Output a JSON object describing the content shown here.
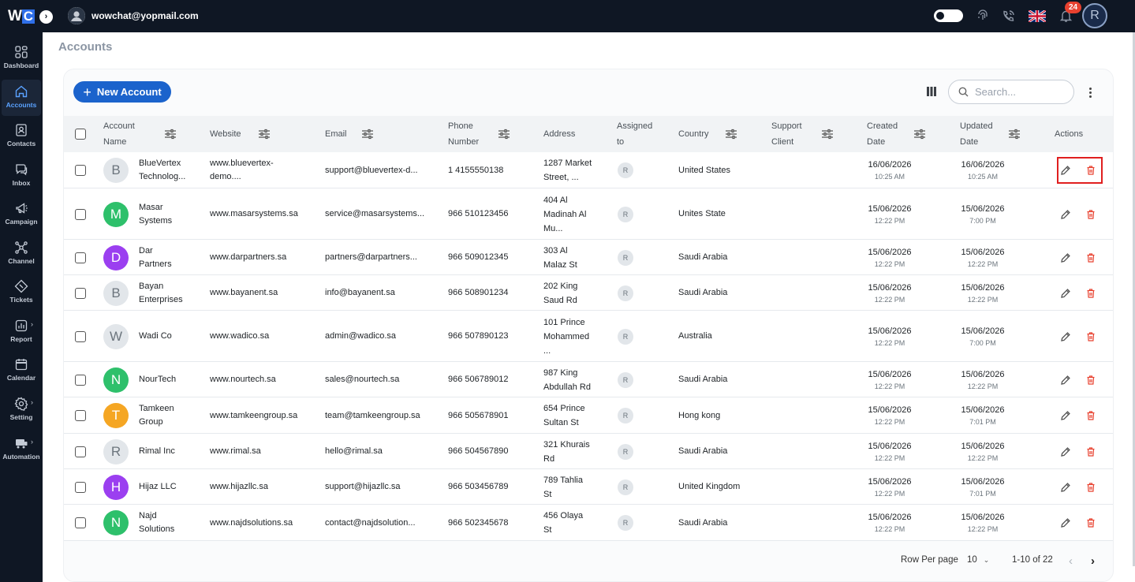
{
  "topbar": {
    "logo_w": "W",
    "logo_c": "C",
    "user_email": "wowchat@yopmail.com",
    "notifications_count": "24",
    "avatar_initial": "R"
  },
  "sidebar": {
    "items": [
      {
        "label": "Dashboard",
        "icon": "dashboard-icon"
      },
      {
        "label": "Accounts",
        "icon": "home-icon",
        "active": true
      },
      {
        "label": "Contacts",
        "icon": "contacts-icon"
      },
      {
        "label": "Inbox",
        "icon": "inbox-icon"
      },
      {
        "label": "Campaign",
        "icon": "megaphone-icon"
      },
      {
        "label": "Channel",
        "icon": "channel-icon"
      },
      {
        "label": "Tickets",
        "icon": "ticket-icon"
      },
      {
        "label": "Report",
        "icon": "report-icon"
      },
      {
        "label": "Calendar",
        "icon": "calendar-icon"
      },
      {
        "label": "Setting",
        "icon": "gear-icon"
      },
      {
        "label": "Automation",
        "icon": "automation-icon"
      }
    ]
  },
  "page": {
    "title": "Accounts",
    "new_button": "New Account",
    "search_placeholder": "Search..."
  },
  "table": {
    "headers": {
      "account_name_1": "Account",
      "account_name_2": "Name",
      "website": "Website",
      "email": "Email",
      "phone_1": "Phone",
      "phone_2": "Number",
      "address": "Address",
      "assigned_1": "Assigned",
      "assigned_2": "to",
      "country": "Country",
      "support_1": "Support",
      "support_2": "Client",
      "created_1": "Created",
      "created_2": "Date",
      "updated_1": "Updated",
      "updated_2": "Date",
      "actions": "Actions"
    },
    "rows": [
      {
        "initial": "B",
        "name1": "BlueVertex",
        "name2": "Technolog...",
        "web1": "www.bluevertex-",
        "web2": "demo....",
        "email": "support@bluevertex-d...",
        "phone": "1 4155550138",
        "addr1": "1287 Market",
        "addr2": "Street, ...",
        "addr3": "",
        "assigned": "R",
        "country": "United States",
        "cdate": "16/06/2026",
        "ctime": "10:25 AM",
        "udate": "16/06/2026",
        "utime": "10:25 AM"
      },
      {
        "initial": "M",
        "name1": "Masar",
        "name2": "Systems",
        "web1": "www.masarsystems.sa",
        "web2": "",
        "email": "service@masarsystems...",
        "phone": "966 510123456",
        "addr1": "404 Al",
        "addr2": "Madinah Al",
        "addr3": "Mu...",
        "assigned": "R",
        "country": "Unites State",
        "cdate": "15/06/2026",
        "ctime": "12:22 PM",
        "udate": "15/06/2026",
        "utime": "7:00 PM"
      },
      {
        "initial": "D",
        "name1": "Dar",
        "name2": "Partners",
        "web1": "www.darpartners.sa",
        "web2": "",
        "email": "partners@darpartners...",
        "phone": "966 509012345",
        "addr1": "303 Al",
        "addr2": "Malaz St",
        "addr3": "",
        "assigned": "R",
        "country": "Saudi Arabia",
        "cdate": "15/06/2026",
        "ctime": "12:22 PM",
        "udate": "15/06/2026",
        "utime": "12:22 PM"
      },
      {
        "initial": "B",
        "name1": "Bayan",
        "name2": "Enterprises",
        "web1": "www.bayanent.sa",
        "web2": "",
        "email": "info@bayanent.sa",
        "phone": "966 508901234",
        "addr1": "202 King",
        "addr2": "Saud Rd",
        "addr3": "",
        "assigned": "R",
        "country": "Saudi Arabia",
        "cdate": "15/06/2026",
        "ctime": "12:22 PM",
        "udate": "15/06/2026",
        "utime": "12:22 PM"
      },
      {
        "initial": "W",
        "name1": "Wadi Co",
        "name2": "",
        "web1": "www.wadico.sa",
        "web2": "",
        "email": "admin@wadico.sa",
        "phone": "966 507890123",
        "addr1": "101 Prince",
        "addr2": "Mohammed",
        "addr3": "...",
        "assigned": "R",
        "country": "Australia",
        "cdate": "15/06/2026",
        "ctime": "12:22 PM",
        "udate": "15/06/2026",
        "utime": "7:00 PM"
      },
      {
        "initial": "N",
        "name1": "NourTech",
        "name2": "",
        "web1": "www.nourtech.sa",
        "web2": "",
        "email": "sales@nourtech.sa",
        "phone": "966 506789012",
        "addr1": "987 King",
        "addr2": "Abdullah Rd",
        "addr3": "",
        "assigned": "R",
        "country": "Saudi Arabia",
        "cdate": "15/06/2026",
        "ctime": "12:22 PM",
        "udate": "15/06/2026",
        "utime": "12:22 PM"
      },
      {
        "initial": "T",
        "name1": "Tamkeen",
        "name2": "Group",
        "web1": "www.tamkeengroup.sa",
        "web2": "",
        "email": "team@tamkeengroup.sa",
        "phone": "966 505678901",
        "addr1": "654 Prince",
        "addr2": "Sultan St",
        "addr3": "",
        "assigned": "R",
        "country": "Hong kong",
        "cdate": "15/06/2026",
        "ctime": "12:22 PM",
        "udate": "15/06/2026",
        "utime": "7:01 PM"
      },
      {
        "initial": "R",
        "name1": "Rimal Inc",
        "name2": "",
        "web1": "www.rimal.sa",
        "web2": "",
        "email": "hello@rimal.sa",
        "phone": "966 504567890",
        "addr1": "321 Khurais",
        "addr2": "Rd",
        "addr3": "",
        "assigned": "R",
        "country": "Saudi Arabia",
        "cdate": "15/06/2026",
        "ctime": "12:22 PM",
        "udate": "15/06/2026",
        "utime": "12:22 PM"
      },
      {
        "initial": "H",
        "name1": "Hijaz LLC",
        "name2": "",
        "web1": "www.hijazllc.sa",
        "web2": "",
        "email": "support@hijazllc.sa",
        "phone": "966 503456789",
        "addr1": "789 Tahlia",
        "addr2": "St",
        "addr3": "",
        "assigned": "R",
        "country": "United Kingdom",
        "cdate": "15/06/2026",
        "ctime": "12:22 PM",
        "udate": "15/06/2026",
        "utime": "7:01 PM"
      },
      {
        "initial": "N",
        "name1": "Najd",
        "name2": "Solutions",
        "web1": "www.najdsolutions.sa",
        "web2": "",
        "email": "contact@najdsolution...",
        "phone": "966 502345678",
        "addr1": "456 Olaya",
        "addr2": "St",
        "addr3": "",
        "assigned": "R",
        "country": "Saudi Arabia",
        "cdate": "15/06/2026",
        "ctime": "12:22 PM",
        "udate": "15/06/2026",
        "utime": "12:22 PM"
      }
    ]
  },
  "pagination": {
    "rows_per_page_label": "Row Per page",
    "rows_per_page": "10",
    "range": "1-10 of 22"
  },
  "colors": {
    "primary": "#1b63cc",
    "sidebar_bg": "#0f1724",
    "delete": "#e8412f",
    "green": "#2ec06b",
    "purple": "#9b3ff0",
    "orange": "#f5a623",
    "grey": "#e2e6ea"
  }
}
